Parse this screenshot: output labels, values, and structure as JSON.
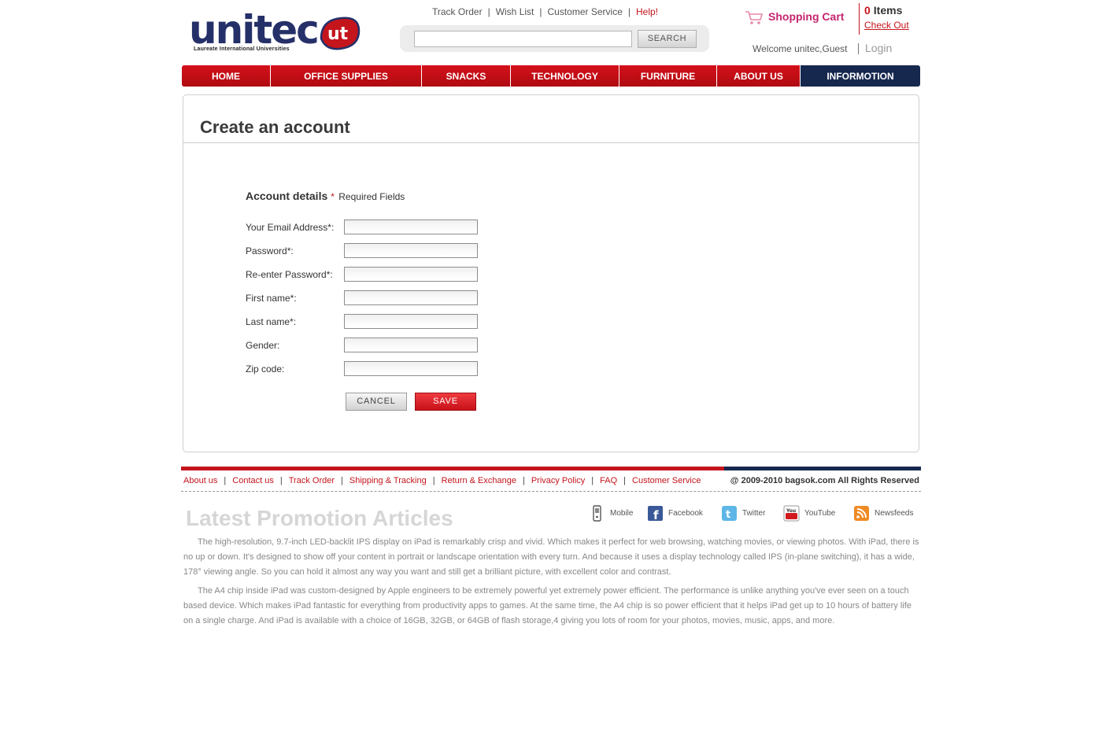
{
  "brand": {
    "name": "unitec",
    "badge": "ut",
    "tagline": "Laureate International Universities"
  },
  "header": {
    "links": [
      "Track Order",
      "Wish List",
      "Customer Service",
      "Help!"
    ],
    "search": {
      "button_label": "SEARCH",
      "value": "",
      "placeholder": ""
    },
    "cart": {
      "label": "Shopping Cart",
      "count": "0",
      "count_label": "Items",
      "checkout_label": "Check Out",
      "icon": "cart-icon"
    },
    "welcome": "Welcome unitec,Guest",
    "login_label": "Login"
  },
  "nav": {
    "items": [
      "HOME",
      "OFFICE SUPPLIES",
      "SNACKS",
      "TECHNOLOGY",
      "FURNITURE",
      "ABOUT US",
      "INFORMOTION"
    ]
  },
  "page": {
    "title": "Create an account",
    "section_title": "Account details",
    "required_star": "*",
    "required_note": "Required Fields",
    "fields": [
      {
        "label": "Your Email Address*:",
        "value": ""
      },
      {
        "label": "Password*:",
        "value": ""
      },
      {
        "label": "Re-enter Password*:",
        "value": ""
      },
      {
        "label": "First name*:",
        "value": ""
      },
      {
        "label": "Last name*:",
        "value": ""
      },
      {
        "label": "Gender:",
        "value": ""
      },
      {
        "label": "Zip code:",
        "value": ""
      }
    ],
    "cancel_label": "CANCEL",
    "save_label": "SAVE"
  },
  "footer": {
    "links": [
      "About us",
      "Contact us",
      "Track Order",
      "Shipping & Tracking",
      "Return & Exchange",
      "Privacy Policy",
      "FAQ",
      "Customer Service"
    ],
    "copyright": "@ 2009-2010 bagsok.com  All Rights Reserved",
    "promo_title": "Latest Promotion Articles",
    "social": [
      {
        "label": "Mobile",
        "icon": "mobile-icon"
      },
      {
        "label": "Facebook",
        "icon": "facebook-icon"
      },
      {
        "label": "Twitter",
        "icon": "twitter-icon"
      },
      {
        "label": "YouTube",
        "icon": "youtube-icon"
      },
      {
        "label": "Newsfeeds",
        "icon": "rss-icon"
      }
    ],
    "paragraphs": [
      "The high-resolution, 9.7-inch LED-backlit IPS display on iPad is remarkably crisp and vivid. Which makes it perfect for web browsing, watching movies, or viewing photos. With iPad, there is no up or down. It's designed to show off your content in portrait or landscape orientation with every turn. And because it uses a display technology called IPS (in-plane switching), it has a wide, 178° viewing angle. So you can hold it almost any way you want and still get a brilliant picture, with excellent color and contrast.",
      "The A4 chip inside iPad was custom-designed by Apple engineers to be extremely powerful yet extremely power efficient. The performance is unlike anything you've ever seen on a touch based device. Which makes iPad fantastic for everything from productivity apps to games. At the same time, the A4 chip is so power efficient that it helps iPad get up to 10 hours of battery life on a single charge. And iPad is available with a choice of 16GB, 32GB, or 64GB of flash storage,4 giving you lots of room for your photos, movies, music, apps, and more."
    ]
  },
  "colors": {
    "brand_red": "#c4151c",
    "navy": "#17284f",
    "cart_pink": "#c4256e"
  }
}
